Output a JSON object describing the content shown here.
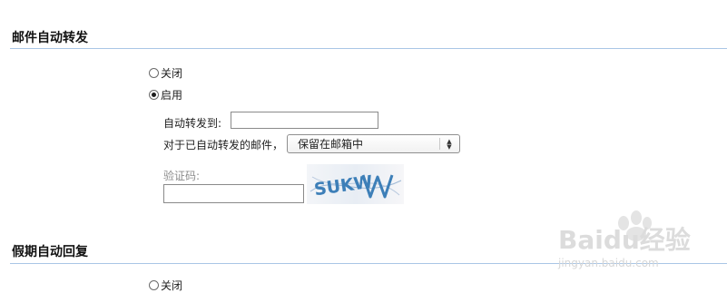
{
  "forward": {
    "title": "邮件自动转发",
    "off_label": "关闭",
    "on_label": "启用",
    "forward_to_label": "自动转发到:",
    "forward_to_value": "",
    "handling_label": "对于已自动转发的邮件，",
    "handling_selected": "保留在邮箱中",
    "captcha_label": "验证码:",
    "captcha_value": "",
    "captcha_text": "SUKW"
  },
  "vacation": {
    "title": "假期自动回复",
    "off_label": "关闭"
  },
  "watermark": {
    "brand": "Baidu经验",
    "url": "jingyan.baidu.com"
  },
  "colors": {
    "divider": "#a9c6e6",
    "captcha_text": "#3d7fb8",
    "watermark": "#d7d7d7"
  }
}
